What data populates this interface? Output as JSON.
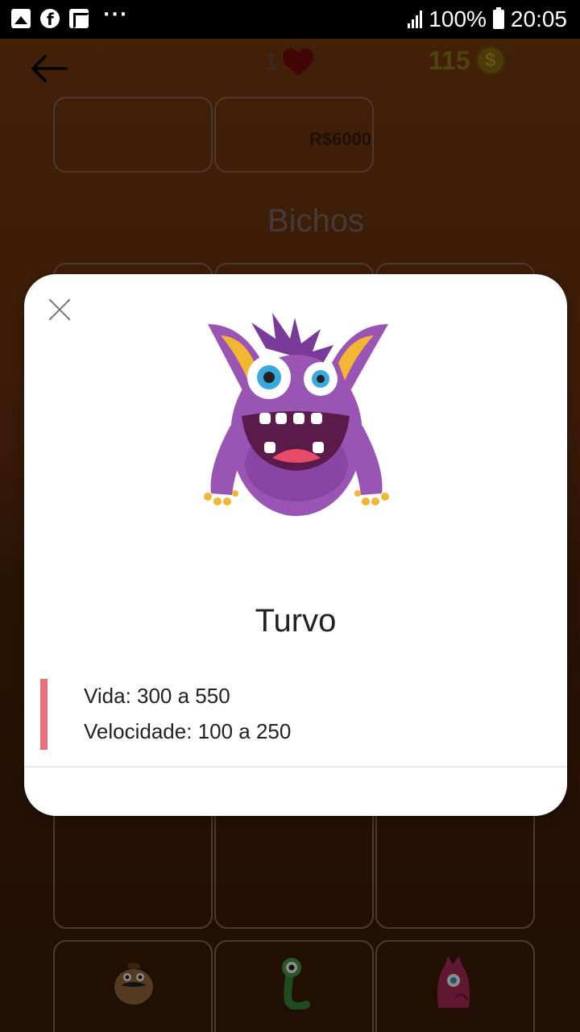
{
  "status_bar": {
    "battery": "100%",
    "time": "20:05",
    "left_icons": [
      "gallery-icon",
      "facebook-icon",
      "flipboard-icon"
    ],
    "overflow": "···"
  },
  "header": {
    "lives": "1",
    "coins": "115",
    "coin_symbol": "$"
  },
  "shop": {
    "price": "R$6000",
    "section_title": "Bichos"
  },
  "modal": {
    "monster_name": "Turvo",
    "stats": {
      "life": "Vida: 300 a 550",
      "speed": "Velocidade: 100 a 250"
    }
  },
  "colors": {
    "accent_bar": "#e87078",
    "monster_purple": "#9a54b4"
  }
}
